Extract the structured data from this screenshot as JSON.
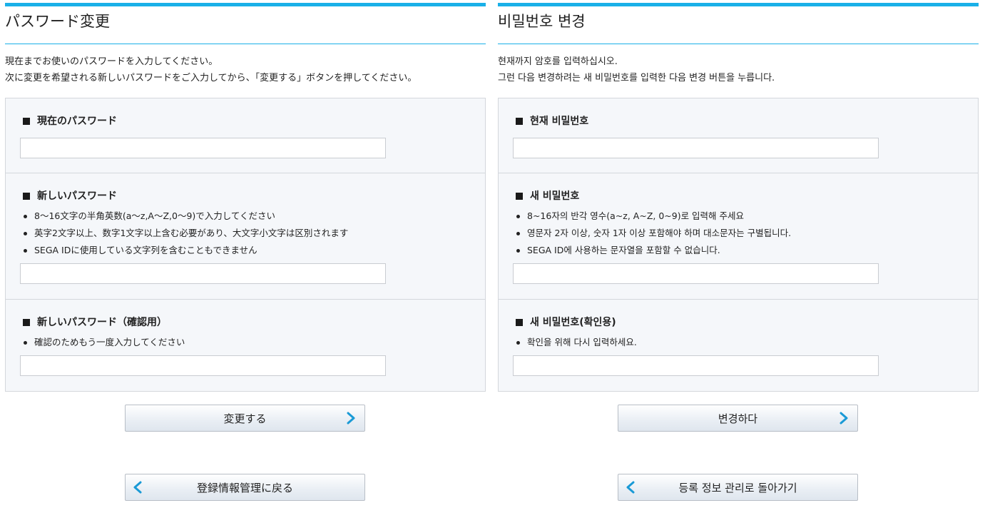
{
  "jp": {
    "title": "パスワード変更",
    "intro_line1": "現在までお使いのパスワードを入力してください。",
    "intro_line2": "次に変更を希望される新しいパスワードをご入力してから、「変更する」ボタンを押してください。",
    "current_label": "現在のパスワード",
    "new_label": "新しいパスワード",
    "new_notes": [
      "8～16文字の半角英数(a～z,A～Z,0～9)で入力してください",
      "英字2文字以上、数字1文字以上含む必要があり、大文字小文字は区別されます",
      "SEGA IDに使用している文字列を含むこともできません"
    ],
    "confirm_label": "新しいパスワード（確認用）",
    "confirm_notes": [
      "確認のためもう一度入力してください"
    ],
    "change_button": "変更する",
    "back_button": "登録情報管理に戻る"
  },
  "kr": {
    "title": "비밀번호 변경",
    "intro_line1": "현재까지 암호를 입력하십시오.",
    "intro_line2": "그런 다음 변경하려는 새 비밀번호를 입력한 다음 변경 버튼을 누릅니다.",
    "current_label": "현재 비밀번호",
    "new_label": "새 비밀번호",
    "new_notes": [
      "8~16자의 반각 영수(a~z, A~Z, 0~9)로 입력해 주세요",
      "영문자 2자 이상, 숫자 1자 이상 포함해야 하며 대소문자는 구별됩니다.",
      "SEGA ID에 사용하는 문자열을 포함할 수 없습니다."
    ],
    "confirm_label": "새 비밀번호(확인용)",
    "confirm_notes": [
      "확인을 위해 다시 입력하세요."
    ],
    "change_button": "변경하다",
    "back_button": "등록 정보 관리로 돌아가기"
  },
  "colors": {
    "accent": "#1ab0e8",
    "arrow": "#1a9ad6",
    "form_bg": "#f5f7fa",
    "border": "#d4d7dc"
  },
  "icons": {
    "next": "chevron-right-icon",
    "back": "chevron-left-icon",
    "bullet": "square-bullet-icon"
  }
}
